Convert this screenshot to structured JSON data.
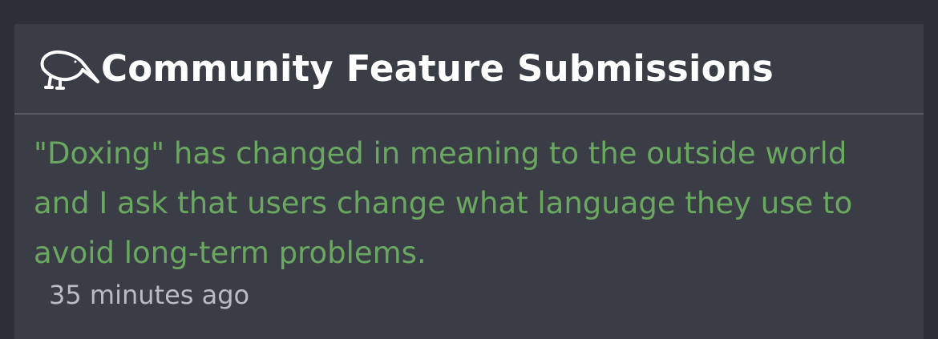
{
  "card": {
    "title": "Community Feature Submissions",
    "icon": "kiwi-bird-icon",
    "submission": {
      "text": "\"Doxing\" has changed in meaning to the outside world and I ask that users change what language they use to avoid long-term problems.",
      "timestamp": "35 minutes ago"
    }
  },
  "colors": {
    "page_background": "#2c2f37",
    "card_background": "#3a3d46",
    "title": "#ffffff",
    "link": "#6aa760",
    "timestamp": "#b9bcc4",
    "divider": "#585b64"
  }
}
